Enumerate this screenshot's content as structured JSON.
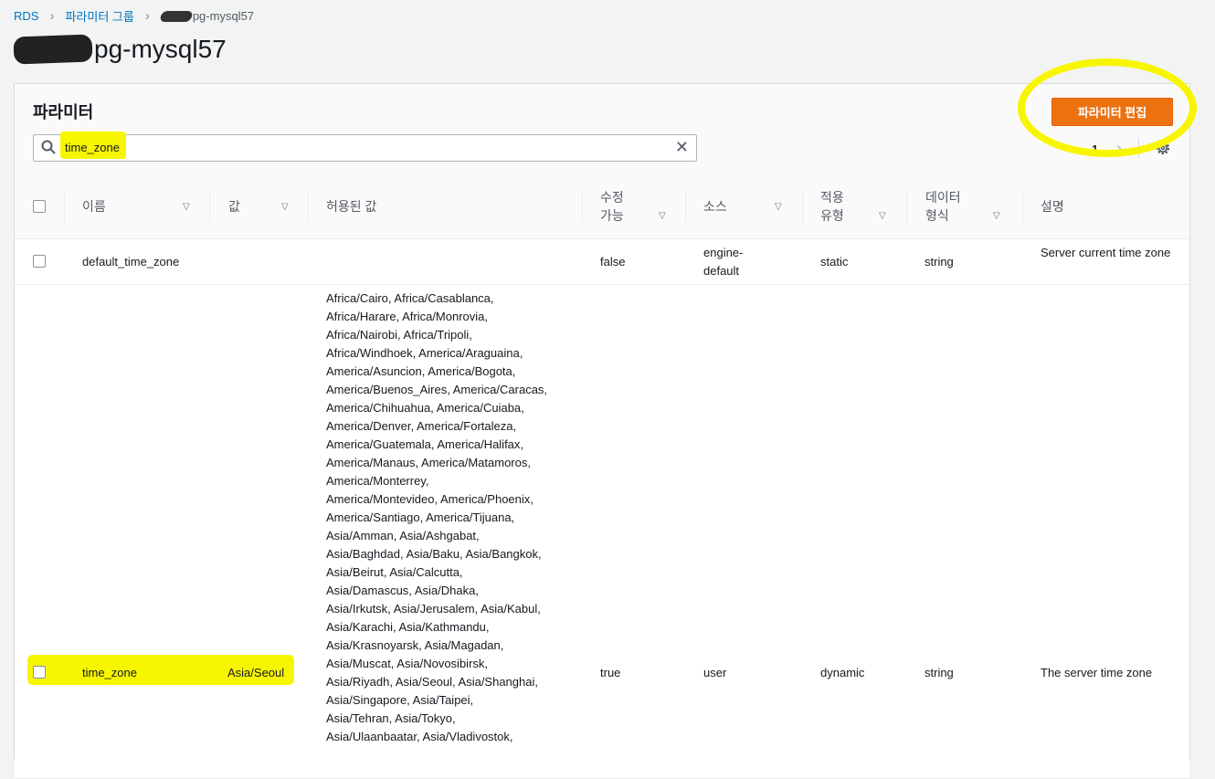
{
  "breadcrumb": {
    "rds": "RDS",
    "param_groups": "파라미터 그룹",
    "current": "pg-mysql57"
  },
  "page_title": "pg-mysql57",
  "panel": {
    "title": "파라미터",
    "edit_button": "파라미터 편집",
    "search_value": "time_zone",
    "page_number": "1"
  },
  "columns": {
    "name": "이름",
    "value": "값",
    "allowed": "허용된 값",
    "modifiable_1": "수정",
    "modifiable_2": "가능",
    "source": "소스",
    "apply_1": "적용",
    "apply_2": "유형",
    "dtype_1": "데이터",
    "dtype_2": "형식",
    "desc": "설명"
  },
  "rows": [
    {
      "name": "default_time_zone",
      "value": "",
      "allowed": "",
      "modifiable": "false",
      "source": "engine-default",
      "apply_type": "static",
      "data_type": "string",
      "description": "Server current time zone"
    },
    {
      "name": "time_zone",
      "value": "Asia/Seoul",
      "allowed": "Africa/Cairo, Africa/Casablanca, Africa/Harare, Africa/Monrovia, Africa/Nairobi, Africa/Tripoli, Africa/Windhoek, America/Araguaina, America/Asuncion, America/Bogota, America/Buenos_Aires, America/Caracas, America/Chihuahua, America/Cuiaba, America/Denver, America/Fortaleza, America/Guatemala, America/Halifax, America/Manaus, America/Matamoros, America/Monterrey, America/Montevideo, America/Phoenix, America/Santiago, America/Tijuana, Asia/Amman, Asia/Ashgabat, Asia/Baghdad, Asia/Baku, Asia/Bangkok, Asia/Beirut, Asia/Calcutta, Asia/Damascus, Asia/Dhaka, Asia/Irkutsk, Asia/Jerusalem, Asia/Kabul, Asia/Karachi, Asia/Kathmandu, Asia/Krasnoyarsk, Asia/Magadan, Asia/Muscat, Asia/Novosibirsk, Asia/Riyadh, Asia/Seoul, Asia/Shanghai, Asia/Singapore, Asia/Taipei, Asia/Tehran, Asia/Tokyo, Asia/Ulaanbaatar, Asia/Vladivostok,",
      "modifiable": "true",
      "source": "user",
      "apply_type": "dynamic",
      "data_type": "string",
      "description": "The server time zone"
    }
  ],
  "allowed_lines": [
    "Africa/Cairo, Africa/Casablanca,",
    "Africa/Harare, Africa/Monrovia,",
    "Africa/Nairobi, Africa/Tripoli,",
    "Africa/Windhoek, America/Araguaina,",
    "America/Asuncion, America/Bogota,",
    "America/Buenos_Aires, America/Caracas,",
    "America/Chihuahua, America/Cuiaba,",
    "America/Denver, America/Fortaleza,",
    "America/Guatemala, America/Halifax,",
    "America/Manaus, America/Matamoros,",
    "America/Monterrey,",
    "America/Montevideo, America/Phoenix,",
    "America/Santiago, America/Tijuana,",
    "Asia/Amman, Asia/Ashgabat,",
    "Asia/Baghdad, Asia/Baku, Asia/Bangkok,",
    "Asia/Beirut, Asia/Calcutta,",
    "Asia/Damascus, Asia/Dhaka,",
    "Asia/Irkutsk, Asia/Jerusalem, Asia/Kabul,",
    "Asia/Karachi, Asia/Kathmandu,",
    "Asia/Krasnoyarsk, Asia/Magadan,",
    "Asia/Muscat, Asia/Novosibirsk,",
    "Asia/Riyadh, Asia/Seoul, Asia/Shanghai,",
    "Asia/Singapore, Asia/Taipei,",
    "Asia/Tehran, Asia/Tokyo,",
    "Asia/Ulaanbaatar, Asia/Vladivostok,"
  ],
  "highlight_color": "#f7f600",
  "accent_color": "#ec7211"
}
